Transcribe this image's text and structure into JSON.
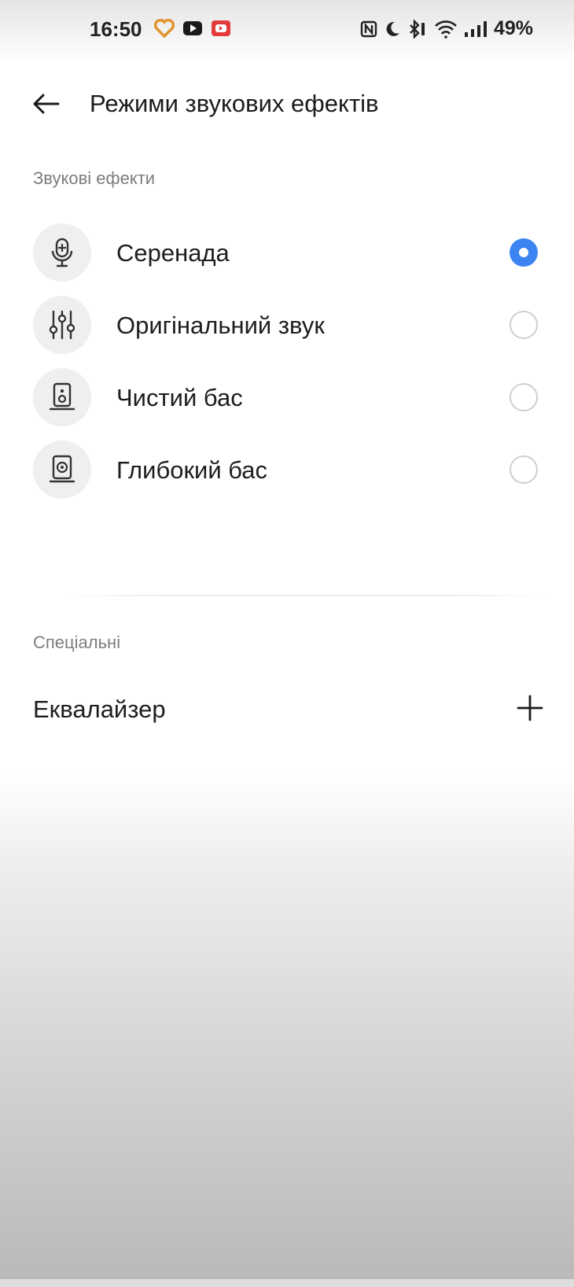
{
  "status_bar": {
    "time": "16:50",
    "battery": "49%",
    "left_icons": [
      "heart-app-icon",
      "youtube-icon",
      "youtube-music-icon"
    ],
    "right_icons": [
      "nfc-icon",
      "moon-icon",
      "bluetooth-icon",
      "wifi-icon",
      "signal-icon"
    ]
  },
  "header": {
    "title": "Режими звукових ефектів",
    "back_icon": "arrow-left-icon"
  },
  "sound_effects": {
    "section_title": "Звукові ефекти",
    "options": [
      {
        "label": "Серенада",
        "icon": "microphone-icon",
        "selected": true
      },
      {
        "label": "Оригінальний звук",
        "icon": "sliders-icon",
        "selected": false
      },
      {
        "label": "Чистий бас",
        "icon": "speaker-icon",
        "selected": false
      },
      {
        "label": "Глибокий бас",
        "icon": "subwoofer-icon",
        "selected": false
      }
    ]
  },
  "special": {
    "section_title": "Спеціальні",
    "equalizer_label": "Еквалайзер",
    "add_icon": "plus-icon"
  },
  "colors": {
    "accent": "#3d84f3",
    "text_primary": "#1d1d1d",
    "text_secondary": "#7d7d7d"
  }
}
